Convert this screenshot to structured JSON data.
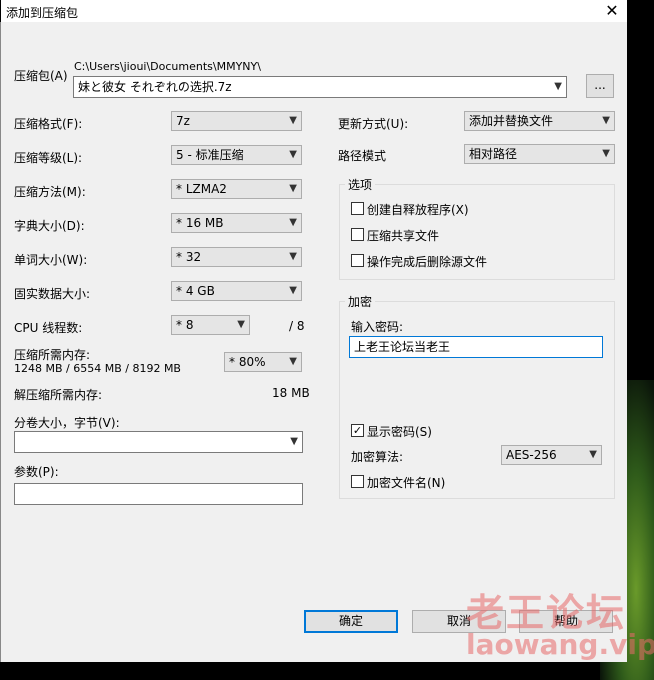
{
  "window": {
    "title": "添加到压缩包",
    "close_glyph": "✕"
  },
  "archive": {
    "label": "压缩包(A)",
    "path": "C:\\Users\\jioui\\Documents\\MMYNY\\",
    "filename": "妹と彼女 それぞれの选択.7z",
    "browse_label": "..."
  },
  "left": {
    "format": {
      "label": "压缩格式(F):",
      "value": "7z"
    },
    "level": {
      "label": "压缩等级(L):",
      "value": "5 - 标准压缩"
    },
    "method": {
      "label": "压缩方法(M):",
      "value": "*  LZMA2"
    },
    "dict": {
      "label": "字典大小(D):",
      "value": "*  16 MB"
    },
    "word": {
      "label": "单词大小(W):",
      "value": "*  32"
    },
    "solid": {
      "label": "固实数据大小:",
      "value": "*  4 GB"
    },
    "cpu": {
      "label": "CPU 线程数:",
      "value": "*  8",
      "total": "/ 8"
    },
    "mem": {
      "label": "压缩所需内存:",
      "detail": "1248 MB / 6554 MB / 8192 MB",
      "value": "* 80%"
    },
    "decomp": {
      "label": "解压缩所需内存:",
      "value": "18 MB"
    },
    "split": {
      "label": "分卷大小，字节(V):",
      "value": ""
    },
    "params": {
      "label": "参数(P):",
      "value": ""
    }
  },
  "right": {
    "update": {
      "label": "更新方式(U):",
      "value": "添加并替换文件"
    },
    "pathmode": {
      "label": "路径模式",
      "value": "相对路径"
    },
    "options": {
      "title": "选项",
      "sfx": "创建自释放程序(X)",
      "shared": "压缩共享文件",
      "delete": "操作完成后删除源文件"
    },
    "encryption": {
      "title": "加密",
      "pw_label": "输入密码:",
      "pw_value": "上老王论坛当老王",
      "show_pw": "显示密码(S)",
      "show_pw_checked": "✓",
      "method_label": "加密算法:",
      "method_value": "AES-256",
      "encrypt_names": "加密文件名(N)"
    }
  },
  "buttons": {
    "ok": "确定",
    "cancel": "取消",
    "help": "帮助"
  },
  "watermark": {
    "line1": "老王论坛",
    "line2": "laowang.vip"
  }
}
